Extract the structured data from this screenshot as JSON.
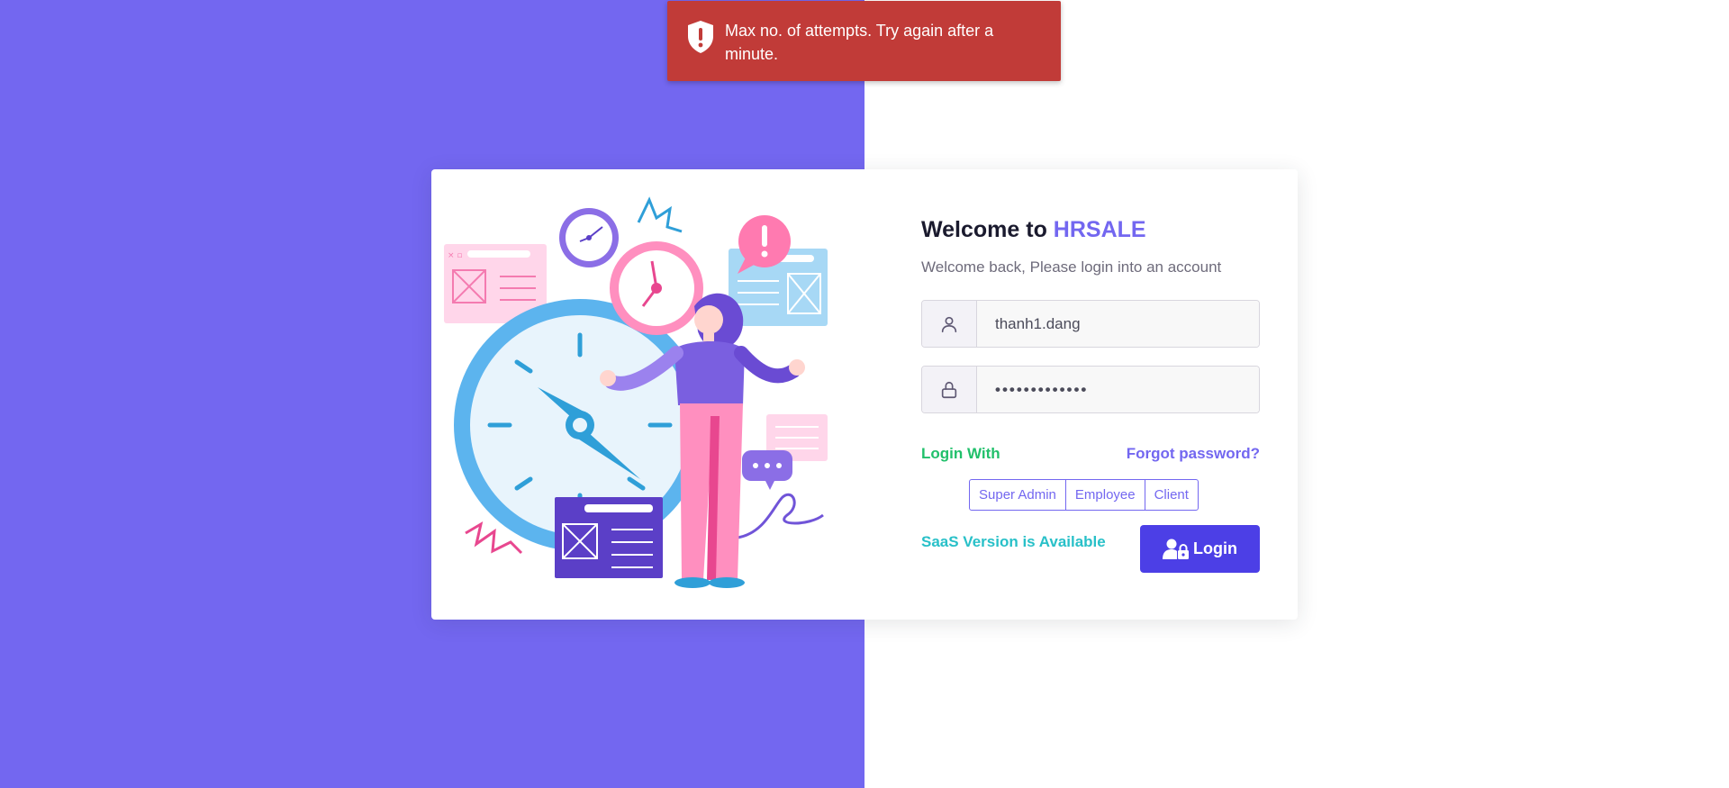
{
  "toast": {
    "message": "Max no. of attempts. Try again after a minute.",
    "icon": "shield-exclamation-icon",
    "color": "#c13b38"
  },
  "brand_color": "#7367f0",
  "login": {
    "title_prefix": "Welcome to ",
    "title_brand": "HRSALE",
    "subtitle": "Welcome back, Please login into an account",
    "username": {
      "value": "thanh1.dang",
      "icon": "user-icon"
    },
    "password": {
      "value": "•••••••••••••",
      "icon": "lock-icon"
    },
    "login_with_label": "Login With",
    "forgot_label": "Forgot password?",
    "roles": [
      "Super Admin",
      "Employee",
      "Client"
    ],
    "saas_label": "SaaS Version is Available",
    "login_button_label": "Login",
    "login_button_icon": "user-lock-icon"
  }
}
